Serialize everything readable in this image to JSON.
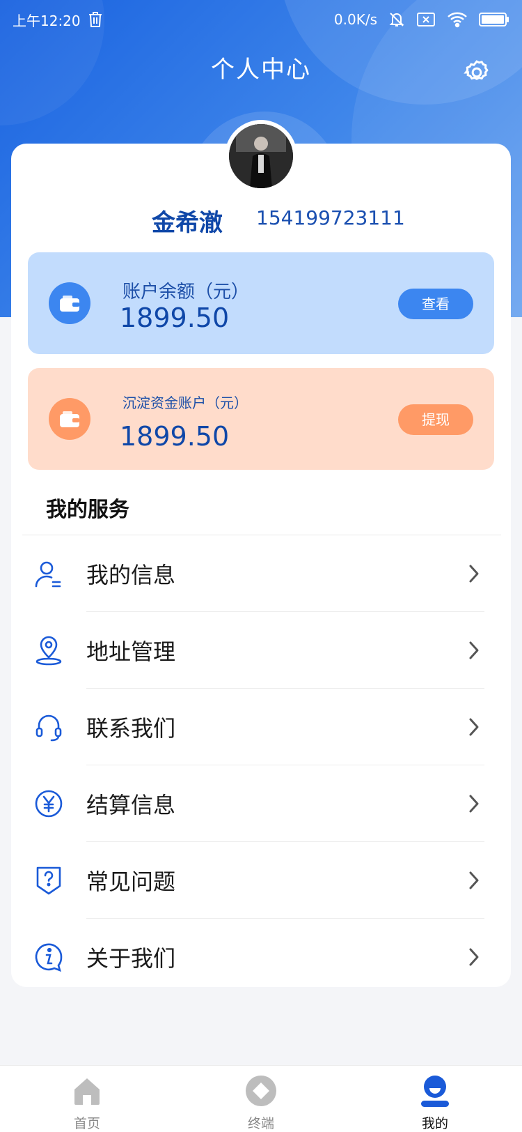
{
  "status_bar": {
    "time": "上午12:20",
    "network_speed": "0.0K/s",
    "icons": [
      "trash-icon",
      "bell-muted-icon",
      "sim-off-icon",
      "wifi-icon",
      "battery-icon"
    ]
  },
  "header": {
    "title": "个人中心",
    "settings_icon": "gear-icon"
  },
  "profile": {
    "name": "金希澈",
    "phone": "154199723111"
  },
  "accounts": [
    {
      "label": "账户余额（元）",
      "amount": "1899.50",
      "button": "查看",
      "icon": "wallet-icon",
      "color": "#3c86f0"
    },
    {
      "label": "沉淀资金账户（元）",
      "amount": "1899.50",
      "button": "提现",
      "icon": "wallet-icon",
      "color": "#ff9a66"
    }
  ],
  "services": {
    "title": "我的服务",
    "items": [
      {
        "label": "我的信息",
        "icon": "user-info-icon"
      },
      {
        "label": "地址管理",
        "icon": "location-pin-icon"
      },
      {
        "label": "联系我们",
        "icon": "headset-icon"
      },
      {
        "label": "结算信息",
        "icon": "yen-icon"
      },
      {
        "label": "常见问题",
        "icon": "question-shield-icon"
      },
      {
        "label": "关于我们",
        "icon": "info-icon"
      }
    ]
  },
  "tabs": [
    {
      "label": "首页",
      "icon": "home-icon",
      "active": false
    },
    {
      "label": "终端",
      "icon": "terminal-diamond-icon",
      "active": false
    },
    {
      "label": "我的",
      "icon": "user-profile-icon",
      "active": true
    }
  ],
  "colors": {
    "primary": "#1a63e0",
    "accent_blue": "#3c86f0",
    "accent_orange": "#ff9a66",
    "text_blue": "#0f47a8"
  }
}
